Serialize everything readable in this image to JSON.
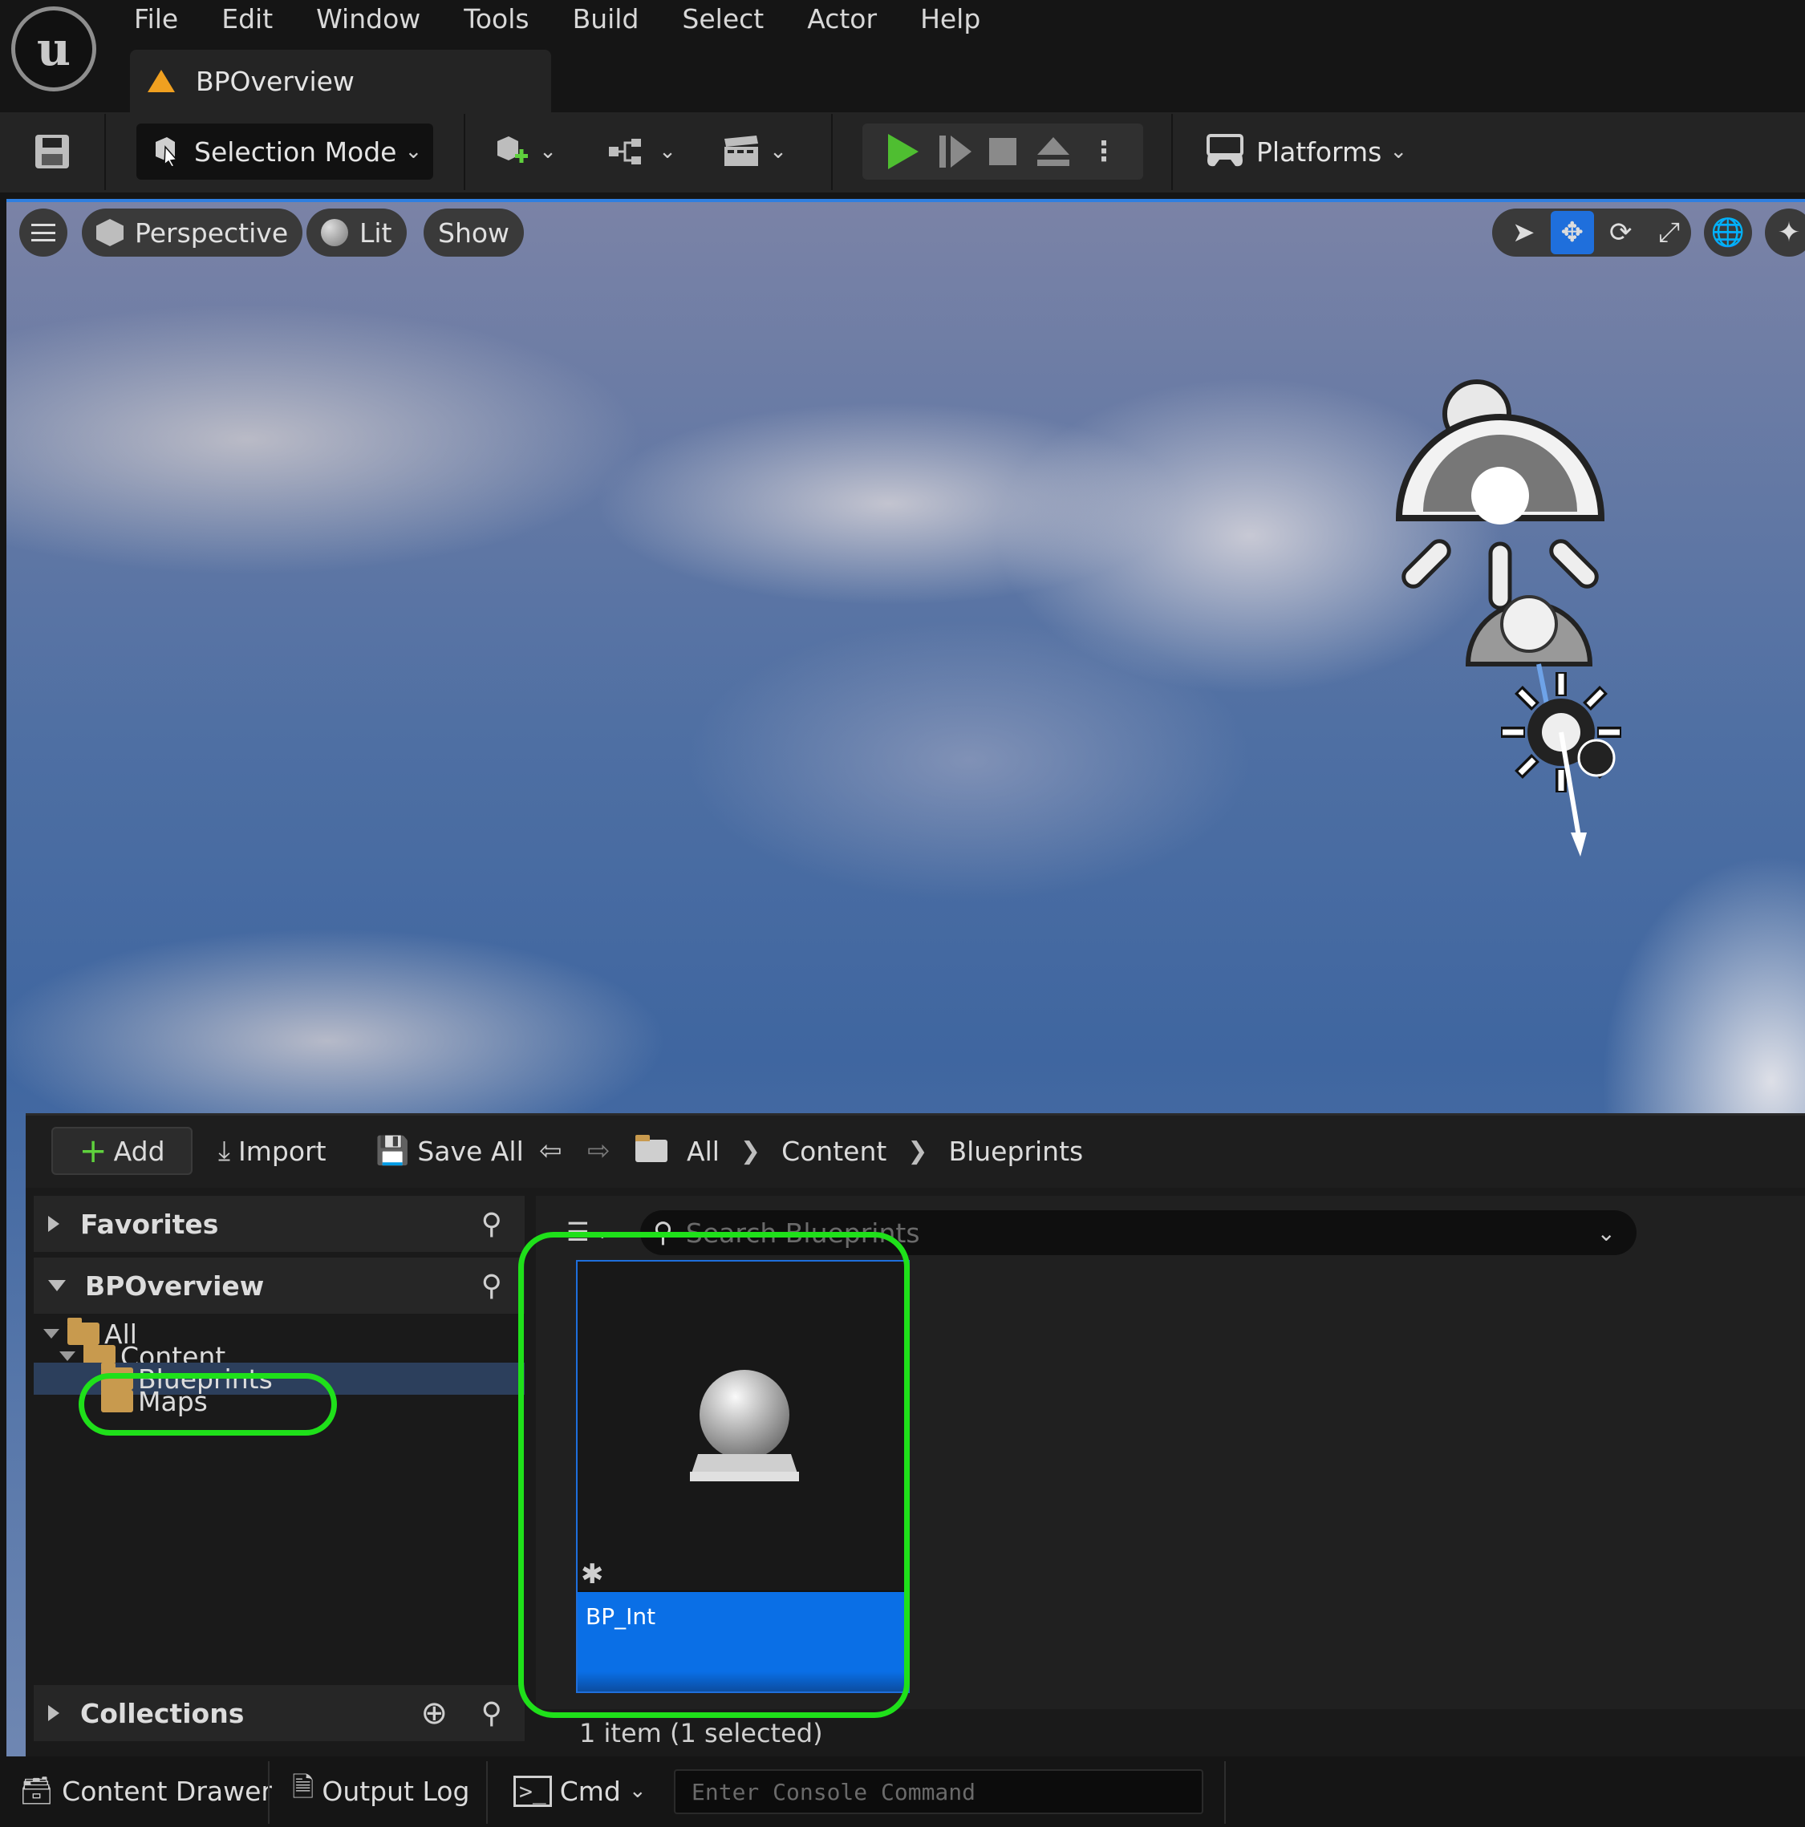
{
  "app": {
    "menu": [
      "File",
      "Edit",
      "Window",
      "Tools",
      "Build",
      "Select",
      "Actor",
      "Help"
    ],
    "document_tab": "BPOverview"
  },
  "toolbar": {
    "selection_mode": "Selection Mode",
    "platforms": "Platforms"
  },
  "viewport": {
    "perspective": "Perspective",
    "lit": "Lit",
    "show": "Show"
  },
  "content_browser": {
    "add": "Add",
    "import": "Import",
    "save_all": "Save All",
    "breadcrumb": [
      "All",
      "Content",
      "Blueprints"
    ],
    "sources": {
      "favorites": "Favorites",
      "project": "BPOverview",
      "collections": "Collections",
      "tree": [
        {
          "label": "All",
          "depth": 0,
          "expanded": true
        },
        {
          "label": "Content",
          "depth": 1,
          "expanded": true
        },
        {
          "label": "Blueprints",
          "depth": 2,
          "selected": true
        },
        {
          "label": "Maps",
          "depth": 2
        }
      ]
    },
    "search": {
      "placeholder": "Search Blueprints",
      "value": ""
    },
    "assets": [
      {
        "name": "BP_Int",
        "selected": true
      }
    ],
    "status": "1 item (1 selected)"
  },
  "bottom_bar": {
    "content_drawer": "Content Drawer",
    "output_log": "Output Log",
    "cmd": "Cmd",
    "console_placeholder": "Enter Console Command"
  },
  "colors": {
    "accent": "#1f6fdc",
    "highlight": "#1fe01a",
    "play": "#4fbe31",
    "folder": "#c89a4e"
  }
}
